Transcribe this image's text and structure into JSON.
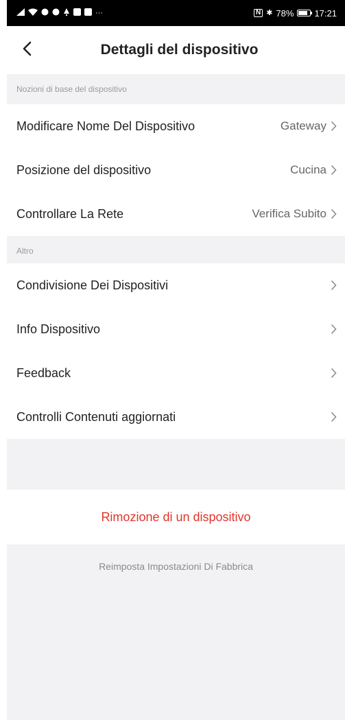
{
  "status_bar": {
    "left_icons": [
      "signal-icon",
      "wifi-icon",
      "data-icon",
      "data-icon",
      "notification-icon",
      "app-icon",
      "app-icon",
      "more-icon"
    ],
    "nfc_label": "N",
    "bluetooth_glyph": "✱",
    "battery": "78%",
    "battery_level": 0.78,
    "time": "17:21",
    "more": "···"
  },
  "header": {
    "back_glyph": "<",
    "title": "Dettagli del dispositivo"
  },
  "section_basics": {
    "title": "Nozioni di base del dispositivo",
    "rows": [
      {
        "label": "Modificare Nome Del Dispositivo",
        "value": "Gateway"
      },
      {
        "label": "Posizione del dispositivo",
        "value": "Cucina"
      },
      {
        "label": "Controllare La Rete",
        "value": "Verifica Subito"
      }
    ]
  },
  "section_other": {
    "title": "Altro",
    "rows": [
      {
        "label": "Condivisione Dei Dispositivi"
      },
      {
        "label": "Info Dispositivo"
      },
      {
        "label": "Feedback"
      },
      {
        "label": "Controlli Contenuti aggiornati"
      }
    ]
  },
  "actions": {
    "remove_label": "Rimozione di un dispositivo",
    "reset_label": "Reimposta Impostazioni Di Fabbrica"
  },
  "colors": {
    "accent_red": "#e0352b",
    "background": "#f2f2f4"
  }
}
